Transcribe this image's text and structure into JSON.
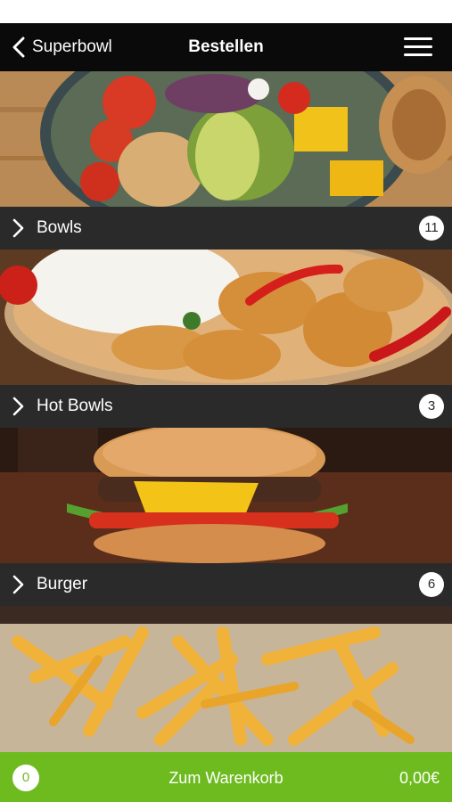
{
  "header": {
    "back_label": "Superbowl",
    "title": "Bestellen",
    "back_icon": "chevron-left-icon",
    "menu_icon": "hamburger-menu-icon"
  },
  "categories": [
    {
      "label": "Bowls",
      "count": "11",
      "image": "salad-bowl-photo"
    },
    {
      "label": "Hot Bowls",
      "count": "3",
      "image": "chicken-rice-photo"
    },
    {
      "label": "Burger",
      "count": "6",
      "image": "burger-photo"
    },
    {
      "label": "",
      "count": "",
      "image": "fries-photo"
    }
  ],
  "cart": {
    "count": "0",
    "label": "Zum Warenkorb",
    "total": "0,00€"
  },
  "colors": {
    "navbar": "#0a0a0a",
    "category_bar": "#2a2a2a",
    "cart_bar": "#6dbb1f"
  }
}
